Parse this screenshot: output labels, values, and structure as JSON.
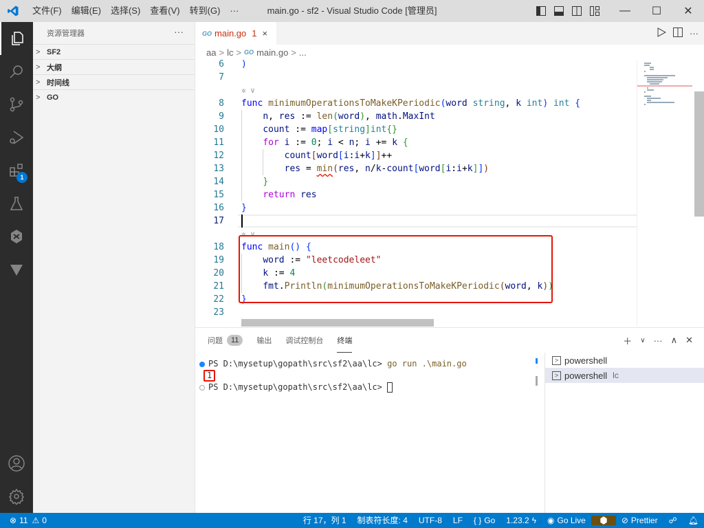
{
  "titlebar": {
    "menu": [
      "文件(F)",
      "编辑(E)",
      "选择(S)",
      "查看(V)",
      "转到(G)",
      "···"
    ],
    "title": "main.go - sf2 - Visual Studio Code [管理员]",
    "min": "—",
    "max": "☐",
    "close": "✕"
  },
  "activity_bar": {
    "extensions_badge": "1"
  },
  "sidebar": {
    "title": "资源管理器",
    "more": "···",
    "sections": [
      "SF2",
      "大纲",
      "时间线",
      "GO"
    ]
  },
  "tab": {
    "icon": "GO",
    "name": "main.go",
    "problems": "1",
    "close": "×"
  },
  "breadcrumb": [
    "aa",
    "lc",
    "main.go",
    "..."
  ],
  "editor": {
    "lines": [
      {
        "n": "6",
        "tokens": [
          [
            "br1",
            ")"
          ]
        ]
      },
      {
        "n": "7",
        "tokens": []
      },
      {
        "n": "8",
        "tokens": [
          [
            "kw",
            "func "
          ],
          [
            "fn",
            "minimumOperationsToMakeKPeriodic"
          ],
          [
            "br1",
            "("
          ],
          [
            "tx",
            "word "
          ],
          [
            "ty",
            "string"
          ],
          [
            "pl",
            ", "
          ],
          [
            "tx",
            "k "
          ],
          [
            "ty",
            "int"
          ],
          [
            "br1",
            ")"
          ],
          [
            "pl",
            " "
          ],
          [
            "ty",
            "int"
          ],
          [
            "pl",
            " "
          ],
          [
            "br1",
            "{"
          ]
        ]
      },
      {
        "n": "9",
        "tokens": [
          [
            "pl",
            "    "
          ],
          [
            "tx",
            "n"
          ],
          [
            "pl",
            ", "
          ],
          [
            "tx",
            "res"
          ],
          [
            "pl",
            " := "
          ],
          [
            "fn",
            "len"
          ],
          [
            "br2",
            "("
          ],
          [
            "tx",
            "word"
          ],
          [
            "br2",
            ")"
          ],
          [
            "pl",
            ", "
          ],
          [
            "tx",
            "math"
          ],
          [
            "pl",
            "."
          ],
          [
            "tx",
            "MaxInt"
          ]
        ]
      },
      {
        "n": "10",
        "tokens": [
          [
            "pl",
            "    "
          ],
          [
            "tx",
            "count"
          ],
          [
            "pl",
            " := "
          ],
          [
            "kw",
            "map"
          ],
          [
            "br2",
            "["
          ],
          [
            "ty",
            "string"
          ],
          [
            "br2",
            "]"
          ],
          [
            "ty",
            "int"
          ],
          [
            "br2",
            "{}"
          ]
        ]
      },
      {
        "n": "11",
        "tokens": [
          [
            "pl",
            "    "
          ],
          [
            "ctl",
            "for "
          ],
          [
            "tx",
            "i"
          ],
          [
            "pl",
            " := "
          ],
          [
            "num",
            "0"
          ],
          [
            "pl",
            "; "
          ],
          [
            "tx",
            "i"
          ],
          [
            "pl",
            " < "
          ],
          [
            "tx",
            "n"
          ],
          [
            "pl",
            "; "
          ],
          [
            "tx",
            "i"
          ],
          [
            "pl",
            " += "
          ],
          [
            "tx",
            "k"
          ],
          [
            "pl",
            " "
          ],
          [
            "br2",
            "{"
          ]
        ]
      },
      {
        "n": "12",
        "tokens": [
          [
            "pl",
            "        "
          ],
          [
            "tx",
            "count"
          ],
          [
            "br3",
            "["
          ],
          [
            "tx",
            "word"
          ],
          [
            "br1",
            "["
          ],
          [
            "tx",
            "i"
          ],
          [
            "pl",
            ":"
          ],
          [
            "tx",
            "i"
          ],
          [
            "pl",
            "+"
          ],
          [
            "tx",
            "k"
          ],
          [
            "br1",
            "]"
          ],
          [
            "br3",
            "]"
          ],
          [
            "pl",
            "++"
          ]
        ]
      },
      {
        "n": "13",
        "tokens": [
          [
            "pl",
            "        "
          ],
          [
            "tx",
            "res"
          ],
          [
            "pl",
            " = "
          ],
          [
            "fnsq",
            "min"
          ],
          [
            "br3",
            "("
          ],
          [
            "tx",
            "res"
          ],
          [
            "pl",
            ", "
          ],
          [
            "tx",
            "n"
          ],
          [
            "pl",
            "/"
          ],
          [
            "tx",
            "k"
          ],
          [
            "pl",
            "-"
          ],
          [
            "tx",
            "count"
          ],
          [
            "br1",
            "["
          ],
          [
            "tx",
            "word"
          ],
          [
            "br2",
            "["
          ],
          [
            "tx",
            "i"
          ],
          [
            "pl",
            ":"
          ],
          [
            "tx",
            "i"
          ],
          [
            "pl",
            "+"
          ],
          [
            "tx",
            "k"
          ],
          [
            "br2",
            "]"
          ],
          [
            "br1",
            "]"
          ],
          [
            "br3",
            ")"
          ]
        ]
      },
      {
        "n": "14",
        "tokens": [
          [
            "pl",
            "    "
          ],
          [
            "br2",
            "}"
          ]
        ]
      },
      {
        "n": "15",
        "tokens": [
          [
            "pl",
            "    "
          ],
          [
            "ctl",
            "return "
          ],
          [
            "tx",
            "res"
          ]
        ]
      },
      {
        "n": "16",
        "tokens": [
          [
            "br1",
            "}"
          ]
        ]
      },
      {
        "n": "17",
        "tokens": []
      },
      {
        "n": "18",
        "tokens": [
          [
            "kw",
            "func "
          ],
          [
            "fn",
            "main"
          ],
          [
            "br1",
            "()"
          ],
          [
            "pl",
            " "
          ],
          [
            "br1",
            "{"
          ]
        ]
      },
      {
        "n": "19",
        "tokens": [
          [
            "pl",
            "    "
          ],
          [
            "tx",
            "word"
          ],
          [
            "pl",
            " := "
          ],
          [
            "str",
            "\"leetcodeleet\""
          ]
        ]
      },
      {
        "n": "20",
        "tokens": [
          [
            "pl",
            "    "
          ],
          [
            "tx",
            "k"
          ],
          [
            "pl",
            " := "
          ],
          [
            "num",
            "4"
          ]
        ]
      },
      {
        "n": "21",
        "tokens": [
          [
            "pl",
            "    "
          ],
          [
            "tx",
            "fmt"
          ],
          [
            "pl",
            "."
          ],
          [
            "fn",
            "Println"
          ],
          [
            "br2",
            "("
          ],
          [
            "fn",
            "minimumOperationsToMakeKPeriodic"
          ],
          [
            "br3",
            "("
          ],
          [
            "tx",
            "word"
          ],
          [
            "pl",
            ", "
          ],
          [
            "tx",
            "k"
          ],
          [
            "br3",
            ")"
          ],
          [
            "br2",
            ")"
          ]
        ]
      },
      {
        "n": "22",
        "tokens": [
          [
            "br1",
            "}"
          ]
        ]
      },
      {
        "n": "23",
        "tokens": []
      }
    ],
    "current_line": "17"
  },
  "panel": {
    "tabs": [
      "问题",
      "输出",
      "调试控制台",
      "终端"
    ],
    "problems_count": "11",
    "active_tab": "终端",
    "terminal": {
      "line1_prompt": "PS D:\\mysetup\\gopath\\src\\sf2\\aa\\lc> ",
      "line1_cmd": "go run .\\main.go",
      "output": "1",
      "line3_prompt": "PS D:\\mysetup\\gopath\\src\\sf2\\aa\\lc> "
    },
    "terminals": [
      {
        "name": "powershell",
        "sub": ""
      },
      {
        "name": "powershell",
        "sub": "lc"
      }
    ]
  },
  "statusbar": {
    "errors": "11",
    "warnings": "0",
    "position": "行 17，列 1",
    "tab_size": "制表符长度: 4",
    "encoding": "UTF-8",
    "eol": "LF",
    "language": "Go",
    "go_version": "1.23.2",
    "go_live": "Go Live",
    "prettier": "Prettier"
  }
}
